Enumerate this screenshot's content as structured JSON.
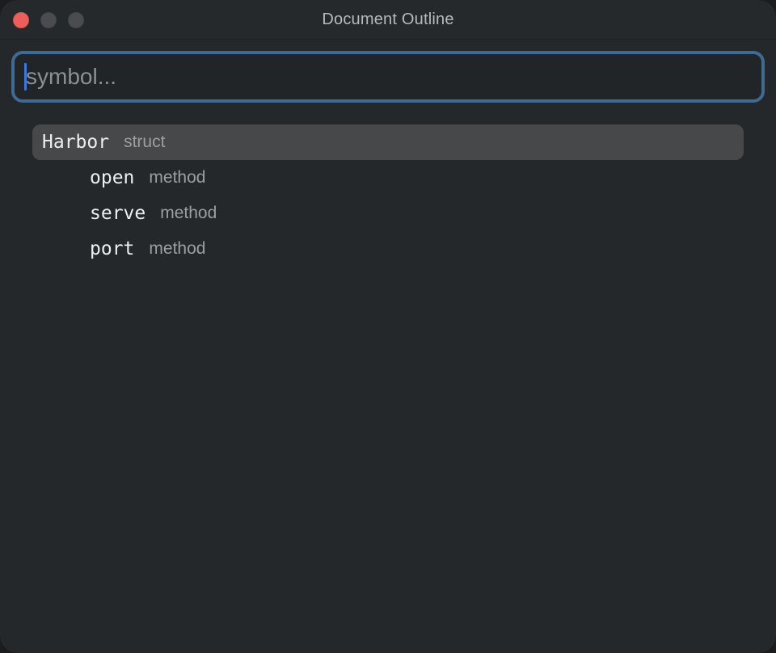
{
  "window": {
    "title": "Document Outline"
  },
  "search": {
    "placeholder": "symbol...",
    "value": ""
  },
  "outline": {
    "items": [
      {
        "name": "Harbor",
        "kind": "struct",
        "depth": 0,
        "selected": true
      },
      {
        "name": "open",
        "kind": "method",
        "depth": 1,
        "selected": false
      },
      {
        "name": "serve",
        "kind": "method",
        "depth": 1,
        "selected": false
      },
      {
        "name": "port",
        "kind": "method",
        "depth": 1,
        "selected": false
      }
    ]
  },
  "colors": {
    "window_bg": "#25282b",
    "focus_ring": "#3e6a93",
    "selection_bg": "#474849",
    "close_button": "#ee5f5b",
    "caret": "#3b79e0"
  }
}
